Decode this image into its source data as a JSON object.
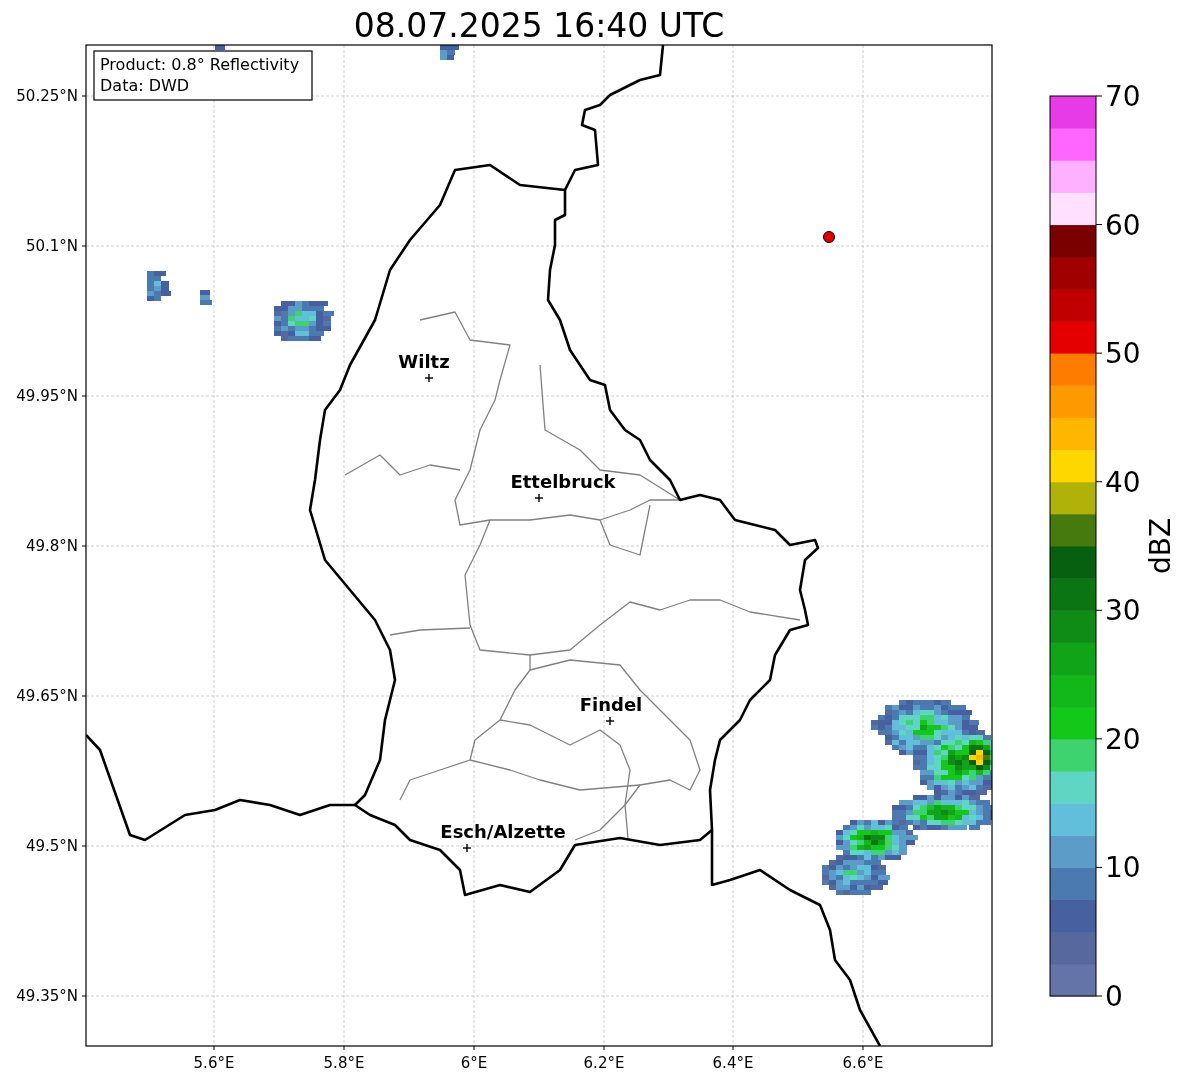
{
  "title": "08.07.2025 16:40 UTC",
  "info_box": [
    "Product: 0.8° Reflectivity",
    "Data: DWD"
  ],
  "lat_ticks": [
    "50.25°N",
    "50.1°N",
    "49.95°N",
    "49.8°N",
    "49.65°N",
    "49.5°N",
    "49.35°N"
  ],
  "lon_ticks": [
    "5.6°E",
    "5.8°E",
    "6°E",
    "6.2°E",
    "6.4°E",
    "6.6°E"
  ],
  "cities": [
    {
      "name": "Wiltz"
    },
    {
      "name": "Ettelbruck"
    },
    {
      "name": "Findel"
    },
    {
      "name": "Esch/Alzette"
    }
  ],
  "colorbar": {
    "label": "dBZ",
    "ticks": [
      "70",
      "60",
      "50",
      "40",
      "30",
      "20",
      "10",
      "0"
    ],
    "bins": [
      {
        "color": "#6474a8"
      },
      {
        "color": "#56699f"
      },
      {
        "color": "#4660a0"
      },
      {
        "color": "#4a7ab0"
      },
      {
        "color": "#5b9dc8"
      },
      {
        "color": "#62bfdc"
      },
      {
        "color": "#5fd6c4"
      },
      {
        "color": "#3dd46f"
      },
      {
        "color": "#14c81a"
      },
      {
        "color": "#12b81a"
      },
      {
        "color": "#10a418"
      },
      {
        "color": "#0e8c16"
      },
      {
        "color": "#0b7512"
      },
      {
        "color": "#07600f"
      },
      {
        "color": "#467a0f"
      },
      {
        "color": "#b0b20a"
      },
      {
        "color": "#fed700"
      },
      {
        "color": "#feb600"
      },
      {
        "color": "#fe9a00"
      },
      {
        "color": "#fe7d00"
      },
      {
        "color": "#e50000"
      },
      {
        "color": "#c00000"
      },
      {
        "color": "#a10000"
      },
      {
        "color": "#7a0000"
      },
      {
        "color": "#ffe0ff"
      },
      {
        "color": "#ffb0ff"
      },
      {
        "color": "#ff66ff"
      },
      {
        "color": "#e83be8"
      }
    ]
  }
}
